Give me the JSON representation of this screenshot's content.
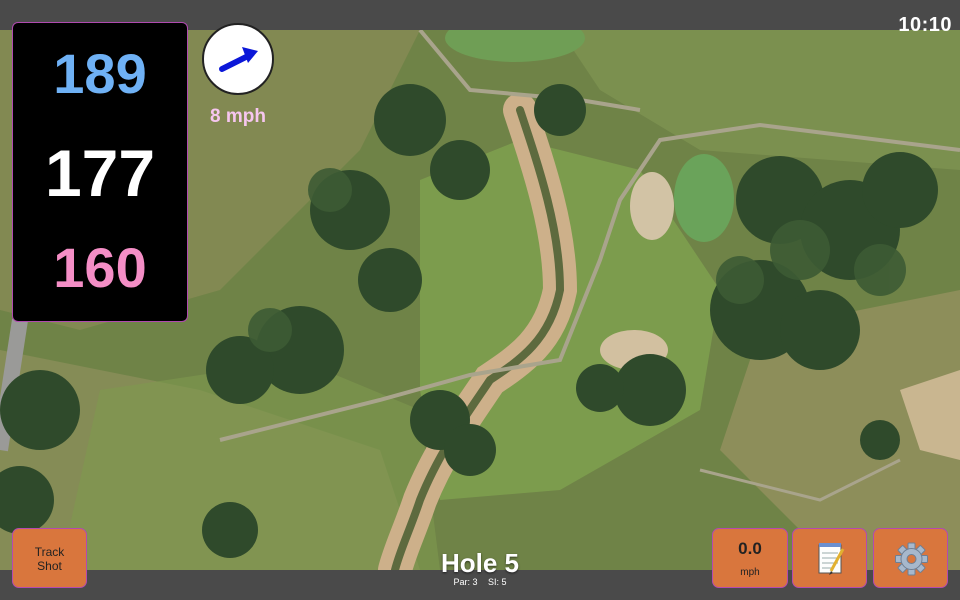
{
  "status": {
    "time": "10:10"
  },
  "distances": {
    "back": "189",
    "middle": "177",
    "front": "160"
  },
  "wind": {
    "speed_text": "8 mph",
    "direction_icon": "arrow-icon"
  },
  "hole": {
    "title": "Hole 5",
    "par": "Par: 3",
    "stroke_index": "SI: 5"
  },
  "buttons": {
    "track_shot": "Track\nShot",
    "speed_value": "0.0",
    "speed_unit": "mph",
    "notes_icon": "notepad-icon",
    "settings_icon": "gear-icon"
  },
  "colors": {
    "back_distance": "#6fb1f5",
    "middle_distance": "#ffffff",
    "front_distance": "#f48ec6",
    "wind_text": "#f6c6ef",
    "button_bg": "#d9763d",
    "accent_border": "#b04ab0"
  }
}
